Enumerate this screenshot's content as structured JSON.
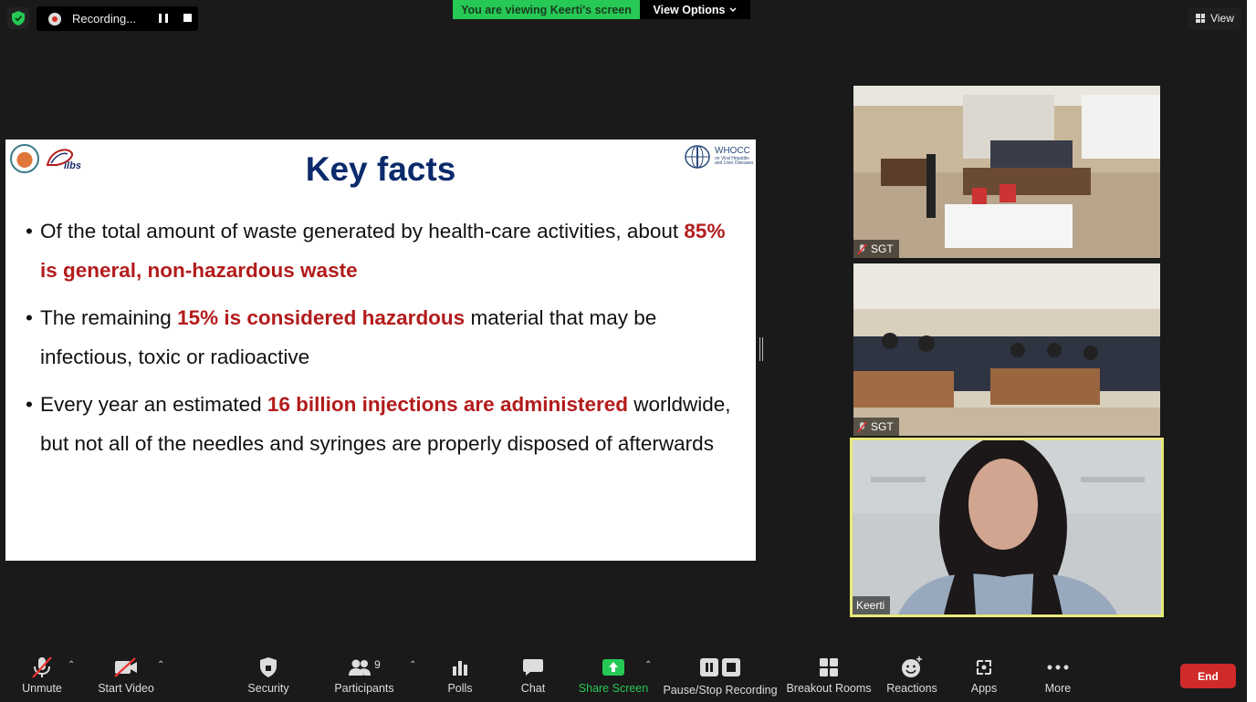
{
  "top_bar": {
    "recording_label": "Recording...",
    "viewing_banner": "You are viewing Keerti's screen",
    "view_options_label": "View Options",
    "view_label": "View"
  },
  "colors": {
    "banner_green": "#26c955",
    "end_red": "#d12a2a",
    "slide_title_blue": "#0a2a6b",
    "highlight_red": "#b31b1b",
    "active_speaker_border": "#e8e87a"
  },
  "slide": {
    "title": "Key facts",
    "logo_text": "ilbs",
    "who_title": "WHOCC",
    "who_subtitle": "on Viral Hepatitis and Liver Diseases",
    "bullets": [
      {
        "pre": "Of the total amount of waste generated by health-care activities, about ",
        "highlight": "85% is general, non-hazardous waste",
        "post": ""
      },
      {
        "pre": "The remaining ",
        "highlight": "15% is considered hazardous",
        "post": " material that may be infectious, toxic or radioactive"
      },
      {
        "pre": "Every year an estimated ",
        "highlight": "16 billion injections are administered",
        "post": " worldwide, but not all of the needles and syringes are properly disposed of afterwards"
      }
    ]
  },
  "participants_tiles": [
    {
      "name": "SGT",
      "muted": true
    },
    {
      "name": "SGT",
      "muted": true
    },
    {
      "name": "Keerti",
      "muted": false,
      "active_speaker": true
    }
  ],
  "toolbar": {
    "unmute": "Unmute",
    "start_video": "Start Video",
    "security": "Security",
    "participants": "Participants",
    "participants_count": "9",
    "polls": "Polls",
    "chat": "Chat",
    "share_screen": "Share Screen",
    "pause_stop_recording": "Pause/Stop Recording",
    "breakout_rooms": "Breakout Rooms",
    "reactions": "Reactions",
    "apps": "Apps",
    "more": "More",
    "end": "End"
  }
}
